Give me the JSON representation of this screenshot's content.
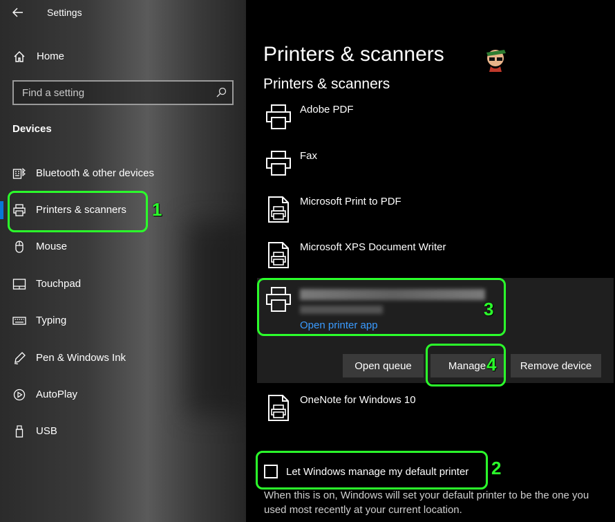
{
  "window": {
    "title": "Settings"
  },
  "sidebar": {
    "home_label": "Home",
    "search_placeholder": "Find a setting",
    "section_title": "Devices",
    "items": [
      {
        "label": "Bluetooth & other devices",
        "icon": "bluetooth-keyboard-icon"
      },
      {
        "label": "Printers & scanners",
        "icon": "printer-icon",
        "selected": true
      },
      {
        "label": "Mouse",
        "icon": "mouse-icon"
      },
      {
        "label": "Touchpad",
        "icon": "touchpad-icon"
      },
      {
        "label": "Typing",
        "icon": "keyboard-icon"
      },
      {
        "label": "Pen & Windows Ink",
        "icon": "pen-icon"
      },
      {
        "label": "AutoPlay",
        "icon": "autoplay-icon"
      },
      {
        "label": "USB",
        "icon": "usb-icon"
      }
    ]
  },
  "main": {
    "page_title": "Printers & scanners",
    "section_title": "Printers & scanners",
    "printers": [
      {
        "name": "Adobe PDF",
        "icon": "printer-icon"
      },
      {
        "name": "Fax",
        "icon": "printer-icon"
      },
      {
        "name": "Microsoft Print to PDF",
        "icon": "document-printer-icon"
      },
      {
        "name": "Microsoft XPS Document Writer",
        "icon": "document-printer-icon"
      },
      {
        "name": "OneNote for Windows 10",
        "icon": "document-printer-icon"
      }
    ],
    "selected_printer": {
      "link": "Open printer app",
      "buttons": {
        "open_queue": "Open queue",
        "manage": "Manage",
        "remove": "Remove device"
      }
    },
    "default_printer": {
      "label": "Let Windows manage my default printer",
      "checked": false,
      "description": "When this is on, Windows will set your default printer to be the one you used most recently at your current location."
    }
  },
  "annotations": [
    "1",
    "2",
    "3",
    "4"
  ],
  "colors": {
    "accent": "#0a78d7",
    "link": "#3a9bff",
    "annotation": "#2bff2b"
  }
}
